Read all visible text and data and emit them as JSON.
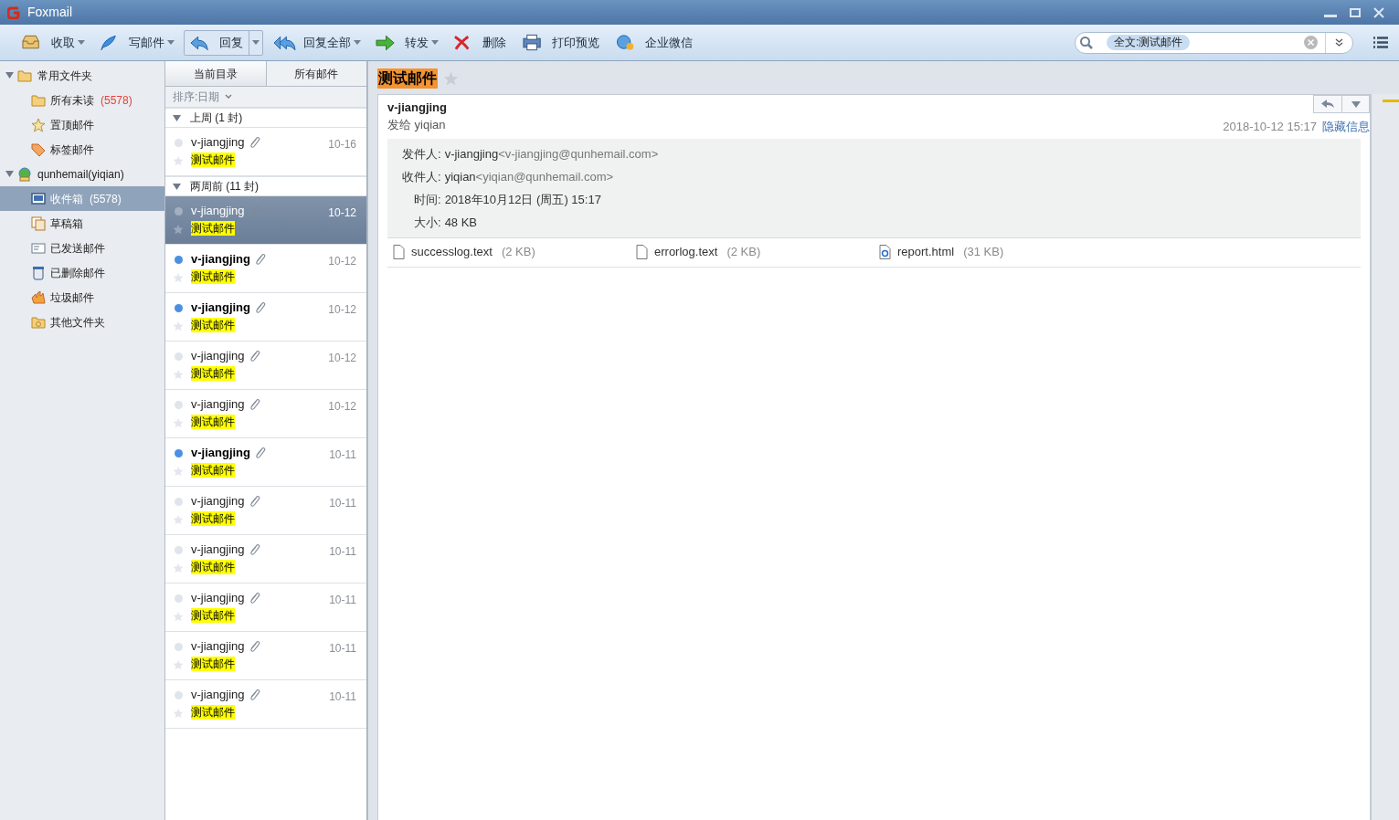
{
  "window": {
    "title": "Foxmail"
  },
  "toolbar": [
    {
      "kind": "receive",
      "label": "收取",
      "dropdown": true
    },
    {
      "kind": "compose",
      "label": "写邮件",
      "dropdown": true
    },
    {
      "kind": "reply",
      "label": "回复",
      "dropdown": true
    },
    {
      "kind": "replyall",
      "label": "回复全部",
      "dropdown": true
    },
    {
      "kind": "forward",
      "label": "转发",
      "dropdown": true
    },
    {
      "kind": "delete",
      "label": "删除",
      "dropdown": false
    },
    {
      "kind": "print",
      "label": "打印预览",
      "dropdown": false
    },
    {
      "kind": "wechat",
      "label": "企业微信",
      "dropdown": false
    }
  ],
  "search": {
    "token": "全文:测试邮件"
  },
  "sidebar": {
    "items": [
      {
        "kind": "folder",
        "label": "常用文件夹",
        "expanded": true,
        "selected": false,
        "children": [
          {
            "kind": "folder",
            "label": "所有未读",
            "count": "(5578)",
            "selected": false
          },
          {
            "kind": "star",
            "label": "置顶邮件",
            "selected": false
          },
          {
            "kind": "tag",
            "label": "标签邮件",
            "selected": false
          }
        ]
      },
      {
        "kind": "account",
        "label": "qunhemail(yiqian)",
        "expanded": true,
        "selected": false,
        "children": [
          {
            "kind": "inbox",
            "label": "收件箱",
            "count": "(5578)",
            "selected": true
          },
          {
            "kind": "drafts",
            "label": "草稿箱",
            "selected": false
          },
          {
            "kind": "sent",
            "label": "已发送邮件",
            "selected": false
          },
          {
            "kind": "trash",
            "label": "已删除邮件",
            "selected": false
          },
          {
            "kind": "junk",
            "label": "垃圾邮件",
            "selected": false
          },
          {
            "kind": "other",
            "label": "其他文件夹",
            "selected": false
          }
        ]
      }
    ]
  },
  "list": {
    "tabs": [
      {
        "label": "当前目录",
        "selected": true
      },
      {
        "label": "所有邮件",
        "selected": false
      }
    ],
    "sort": "排序:日期",
    "groups": [
      {
        "label": "上周 (1 封)",
        "expanded": true,
        "messages": [
          {
            "sender": "v-jiangjing",
            "subject": "测试邮件",
            "date": "10-16",
            "unread": false,
            "selected": false
          }
        ]
      },
      {
        "label": "两周前 (11 封)",
        "expanded": true,
        "messages": [
          {
            "sender": "v-jiangjing",
            "subject": "测试邮件",
            "date": "10-12",
            "unread": false,
            "selected": true
          },
          {
            "sender": "v-jiangjing",
            "subject": "测试邮件",
            "date": "10-12",
            "unread": true,
            "selected": false
          },
          {
            "sender": "v-jiangjing",
            "subject": "测试邮件",
            "date": "10-12",
            "unread": true,
            "selected": false
          },
          {
            "sender": "v-jiangjing",
            "subject": "测试邮件",
            "date": "10-12",
            "unread": false,
            "selected": false
          },
          {
            "sender": "v-jiangjing",
            "subject": "测试邮件",
            "date": "10-12",
            "unread": false,
            "selected": false
          },
          {
            "sender": "v-jiangjing",
            "subject": "测试邮件",
            "date": "10-11",
            "unread": true,
            "selected": false
          },
          {
            "sender": "v-jiangjing",
            "subject": "测试邮件",
            "date": "10-11",
            "unread": false,
            "selected": false
          },
          {
            "sender": "v-jiangjing",
            "subject": "测试邮件",
            "date": "10-11",
            "unread": false,
            "selected": false
          },
          {
            "sender": "v-jiangjing",
            "subject": "测试邮件",
            "date": "10-11",
            "unread": false,
            "selected": false
          },
          {
            "sender": "v-jiangjing",
            "subject": "测试邮件",
            "date": "10-11",
            "unread": false,
            "selected": false
          },
          {
            "sender": "v-jiangjing",
            "subject": "测试邮件",
            "date": "10-11",
            "unread": false,
            "selected": false
          }
        ]
      }
    ]
  },
  "message": {
    "subject": "测试邮件",
    "sender": "v-jiangjing",
    "to_line": "发给 yiqian",
    "datetime": "2018-10-12 15:17",
    "toggle": "隐藏信息",
    "details": [
      {
        "label": "发件人:",
        "name": "v-jiangjing",
        "address": "<v-jiangjing@qunhemail.com>"
      },
      {
        "label": "收件人:",
        "name": "yiqian",
        "address": "<yiqian@qunhemail.com>"
      },
      {
        "label": "时间:",
        "name": "2018年10月12日 (周五) 15:17"
      },
      {
        "label": "大小:",
        "name": "48 KB"
      }
    ],
    "attachments": [
      {
        "kind": "file",
        "name": "successlog.text",
        "size": "(2 KB)"
      },
      {
        "kind": "file",
        "name": "errorlog.text",
        "size": "(2 KB)"
      },
      {
        "kind": "html",
        "name": "report.html",
        "size": "(31 KB)"
      }
    ]
  }
}
